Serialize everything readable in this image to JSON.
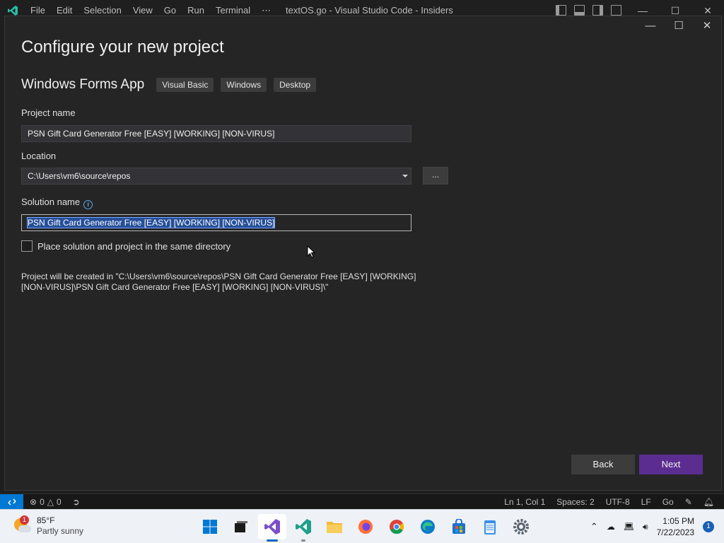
{
  "vscode": {
    "menu": [
      "File",
      "Edit",
      "Selection",
      "View",
      "Go",
      "Run",
      "Terminal",
      "⋯"
    ],
    "window_title": "textOS.go - Visual Studio Code - Insiders"
  },
  "dialog": {
    "title": "Configure your new project",
    "template_name": "Windows Forms App",
    "tags": [
      "Visual Basic",
      "Windows",
      "Desktop"
    ],
    "project_name_label": "Project name",
    "project_name_value": "PSN Gift Card Generator Free [EASY] [WORKING] [NON-VIRUS]",
    "location_label": "Location",
    "location_value": "C:\\Users\\vm6\\source\\repos",
    "browse_label": "...",
    "solution_name_label": "Solution name",
    "solution_name_value": "PSN Gift Card Generator Free [EASY] [WORKING] [NON-VIRUS]",
    "same_dir_label": "Place solution and project in the same directory",
    "same_dir_checked": false,
    "path_note": "Project will be created in \"C:\\Users\\vm6\\source\\repos\\PSN Gift Card Generator Free [EASY] [WORKING] [NON-VIRUS]\\PSN Gift Card Generator Free [EASY] [WORKING] [NON-VIRUS]\\\"",
    "back_label": "Back",
    "next_label": "Next"
  },
  "statusbar": {
    "errors": "0",
    "warnings": "0",
    "position": "Ln 1, Col 1",
    "spaces": "Spaces: 2",
    "encoding": "UTF-8",
    "eol": "LF",
    "language": "Go"
  },
  "taskbar": {
    "weather_temp": "85°F",
    "weather_condition": "Partly sunny",
    "weather_badge": "1",
    "time": "1:05 PM",
    "date": "7/22/2023",
    "notification_count": "1",
    "apps": [
      "start-icon",
      "task-view-icon",
      "visual-studio-icon",
      "vscode-icon",
      "file-explorer-icon",
      "firefox-icon",
      "chrome-icon",
      "edge-icon",
      "store-icon",
      "notepad-icon",
      "settings-icon"
    ]
  },
  "colors": {
    "accent_next": "#5c2d91",
    "remote_blue": "#0078d4",
    "selection": "#264f99"
  }
}
